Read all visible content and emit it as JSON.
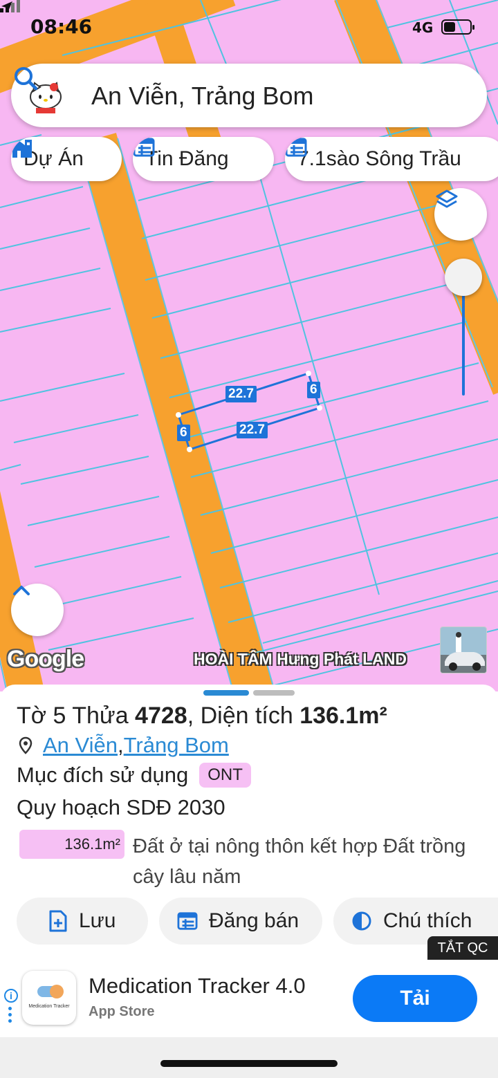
{
  "status": {
    "time": "08:46",
    "network": "4G"
  },
  "search": {
    "query": "An Viễn, Trảng Bom"
  },
  "chips": [
    {
      "label": "Dự Án",
      "icon": "building-icon"
    },
    {
      "label": "Tin Đăng",
      "icon": "listing-icon"
    },
    {
      "label": "7.1sào Sông Trầu",
      "icon": "listing-icon"
    }
  ],
  "map": {
    "brand": "Google",
    "watermark": "HOÀI TÂM Hưng Phát LAND",
    "dimensions": {
      "top": "22.7",
      "bottom": "22.7",
      "left": "6",
      "right": "6"
    },
    "colors": {
      "land": "#f7b7f2",
      "road": "#f7a12e",
      "parcel_line": "#4fc3e0",
      "selection": "#1e73d8"
    }
  },
  "parcel": {
    "title_prefix": "Tờ 5 Thửa ",
    "parcel_no": "4728",
    "title_mid": ", Diện tích ",
    "area": "136.1m²",
    "loc_ward": "An Viễn",
    "loc_sep": ", ",
    "loc_district": "Trảng Bom",
    "usage_label": "Mục đích sử dụng",
    "usage_code": "ONT",
    "plan_title": "Quy hoạch SDĐ 2030",
    "plan_area": "136.1m²",
    "plan_desc": "Đất ở tại nông thôn kết hợp Đất trồng cây lâu năm"
  },
  "actions": {
    "save": "Lưu",
    "post": "Đăng bán",
    "legend": "Chú thích"
  },
  "ad": {
    "close": "TẮT QC",
    "icon_text": "Medication Tracker",
    "title": "Medication Tracker 4.0",
    "store": "App Store",
    "cta": "Tải"
  }
}
